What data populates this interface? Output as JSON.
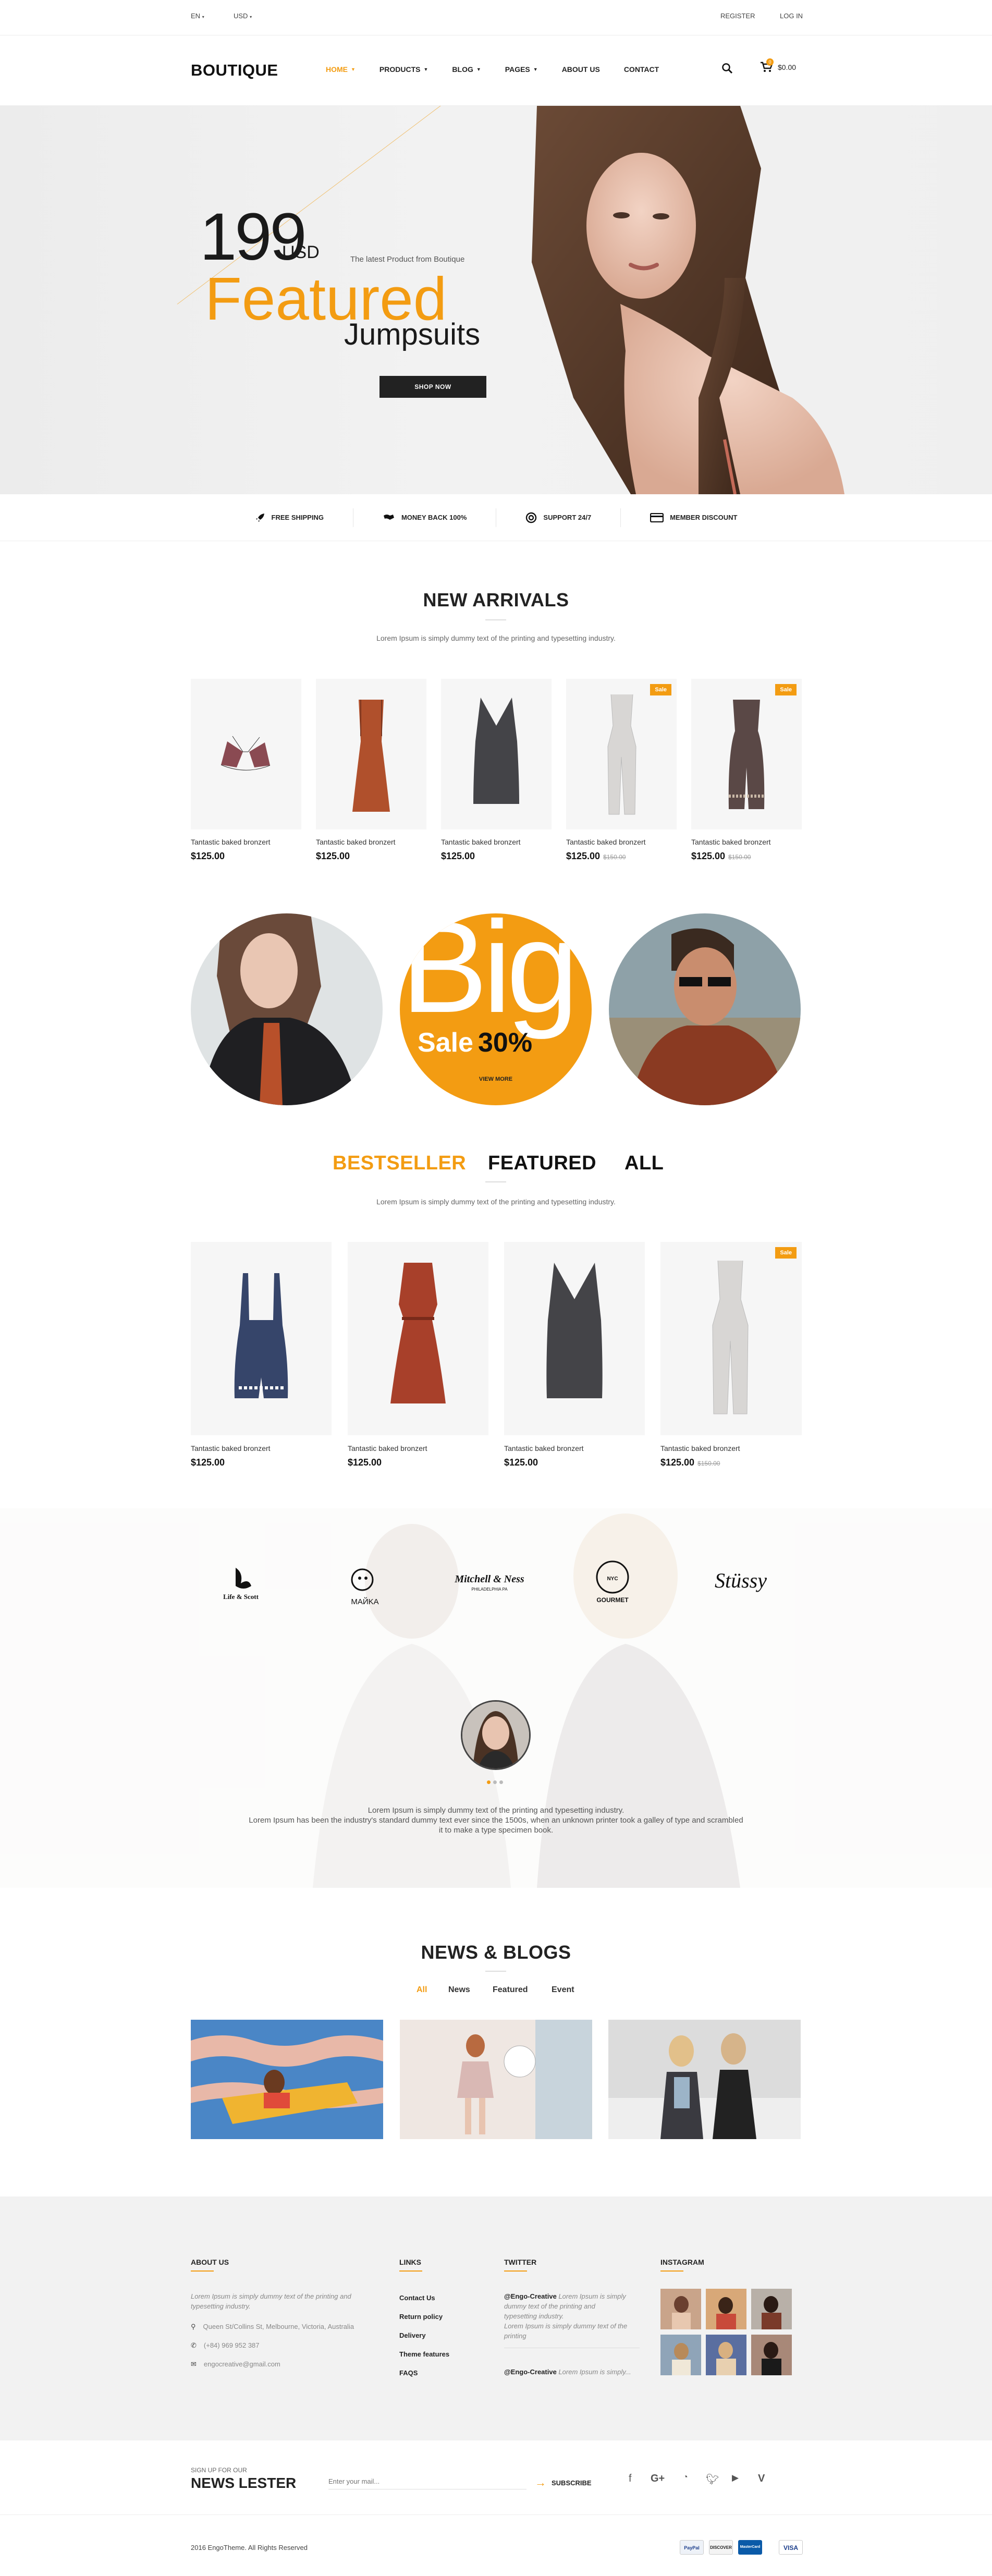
{
  "topbar": {
    "language": "EN",
    "currency": "USD",
    "register": "REGISTER",
    "login": "LOG IN"
  },
  "header": {
    "logo": "BOUTIQUE",
    "nav": [
      "HOME",
      "PRODUCTS",
      "BLOG",
      "PAGES",
      "ABOUT US",
      "CONTACT"
    ],
    "cart_count": "0",
    "cart_total": "$0.00"
  },
  "hero": {
    "price": "199",
    "currency": "USD",
    "tagline": "The latest Product from Boutique",
    "headline": "Featured",
    "subheadline": "Jumpsuits",
    "cta": "SHOP NOW"
  },
  "features": [
    "FREE SHIPPING",
    "MONEY BACK 100%",
    "SUPPORT 24/7",
    "MEMBER DISCOUNT"
  ],
  "new_arrivals": {
    "title": "NEW ARRIVALS",
    "subtitle": "Lorem Ipsum is simply dummy text of the printing and typesetting industry.",
    "products": [
      {
        "name": "Tantastic baked bronzert",
        "price": "$125.00",
        "old_price": "",
        "sale": ""
      },
      {
        "name": "Tantastic baked bronzert",
        "price": "$125.00",
        "old_price": "",
        "sale": ""
      },
      {
        "name": "Tantastic baked bronzert",
        "price": "$125.00",
        "old_price": "",
        "sale": ""
      },
      {
        "name": "Tantastic baked bronzert",
        "price": "$125.00",
        "old_price": "$150.00",
        "sale": "Sale"
      },
      {
        "name": "Tantastic baked bronzert",
        "price": "$125.00",
        "old_price": "$150.00",
        "sale": "Sale"
      }
    ]
  },
  "promo": {
    "big": "Big",
    "sale": "Sale",
    "percent": "30%",
    "view_more": "VIEW MORE"
  },
  "tabs": {
    "items": [
      "BESTSELLER",
      "FEATURED",
      "ALL"
    ],
    "subtitle": "Lorem Ipsum is simply dummy text of the printing and typesetting industry.",
    "products": [
      {
        "name": "Tantastic baked bronzert",
        "price": "$125.00",
        "old_price": "",
        "sale": ""
      },
      {
        "name": "Tantastic baked bronzert",
        "price": "$125.00",
        "old_price": "",
        "sale": ""
      },
      {
        "name": "Tantastic baked bronzert",
        "price": "$125.00",
        "old_price": "",
        "sale": ""
      },
      {
        "name": "Tantastic baked bronzert",
        "price": "$125.00",
        "old_price": "$150.00",
        "sale": "Sale"
      }
    ]
  },
  "brands": [
    "Life & Scott",
    "MAЙKA",
    "Mitchell & Ness",
    "NYC GOURMET",
    "Stüssy"
  ],
  "testimonial": {
    "line1": "Lorem Ipsum is simply dummy text of the printing and typesetting industry.",
    "line2": "Lorem Ipsum has been the industry's standard dummy text ever since the 1500s, when an unknown printer took a galley of type and scrambled",
    "line3": "it to make a type specimen book."
  },
  "blogs": {
    "title": "NEWS & BLOGS",
    "tabs": [
      "All",
      "News",
      "Featured",
      "Event"
    ]
  },
  "footer": {
    "about": {
      "title": "ABOUT US",
      "text1": "Lorem Ipsum is simply dummy text of the printing and",
      "text2": "typesetting industry.",
      "address": "Queen St/Collins St, Melbourne, Victoria, Australia",
      "phone": "(+84) 969 952 387",
      "email": "engocreative@gmail.com"
    },
    "links": {
      "title": "LINKS",
      "items": [
        "Contact Us",
        "Return policy",
        "Delivery",
        "Theme features",
        "FAQS"
      ]
    },
    "twitter": {
      "title": "TWITTER",
      "tweet1_user": "@Engo-Creative",
      "tweet1_l1": "Lorem Ipsum is simply",
      "tweet1_l2": "dummy text of the printing and",
      "tweet1_l3": "typesetting industry.",
      "tweet1_l4": "Lorem Ipsum is simply dummy text of the",
      "tweet1_l5": "printing",
      "tweet2_user": "@Engo-Creative",
      "tweet2_text": "Lorem Ipsum is simply..."
    },
    "instagram": {
      "title": "INSTAGRAM"
    }
  },
  "newsletter": {
    "signup": "SIGN UP FOR OUR",
    "title": "NEWS LESTER",
    "placeholder": "Enter your mail...",
    "button": "SUBSCRIBE"
  },
  "social": [
    "facebook-icon",
    "google-plus-icon",
    "rss-icon",
    "twitter-icon",
    "youtube-icon",
    "vine-icon"
  ],
  "copyright": "2016 EngoTheme. All Rights Reserved",
  "payments": [
    "PayPal",
    "DISCOVER",
    "MasterCard",
    "VISA"
  ],
  "colors": {
    "accent": "#f39c12",
    "dark": "#222222"
  }
}
